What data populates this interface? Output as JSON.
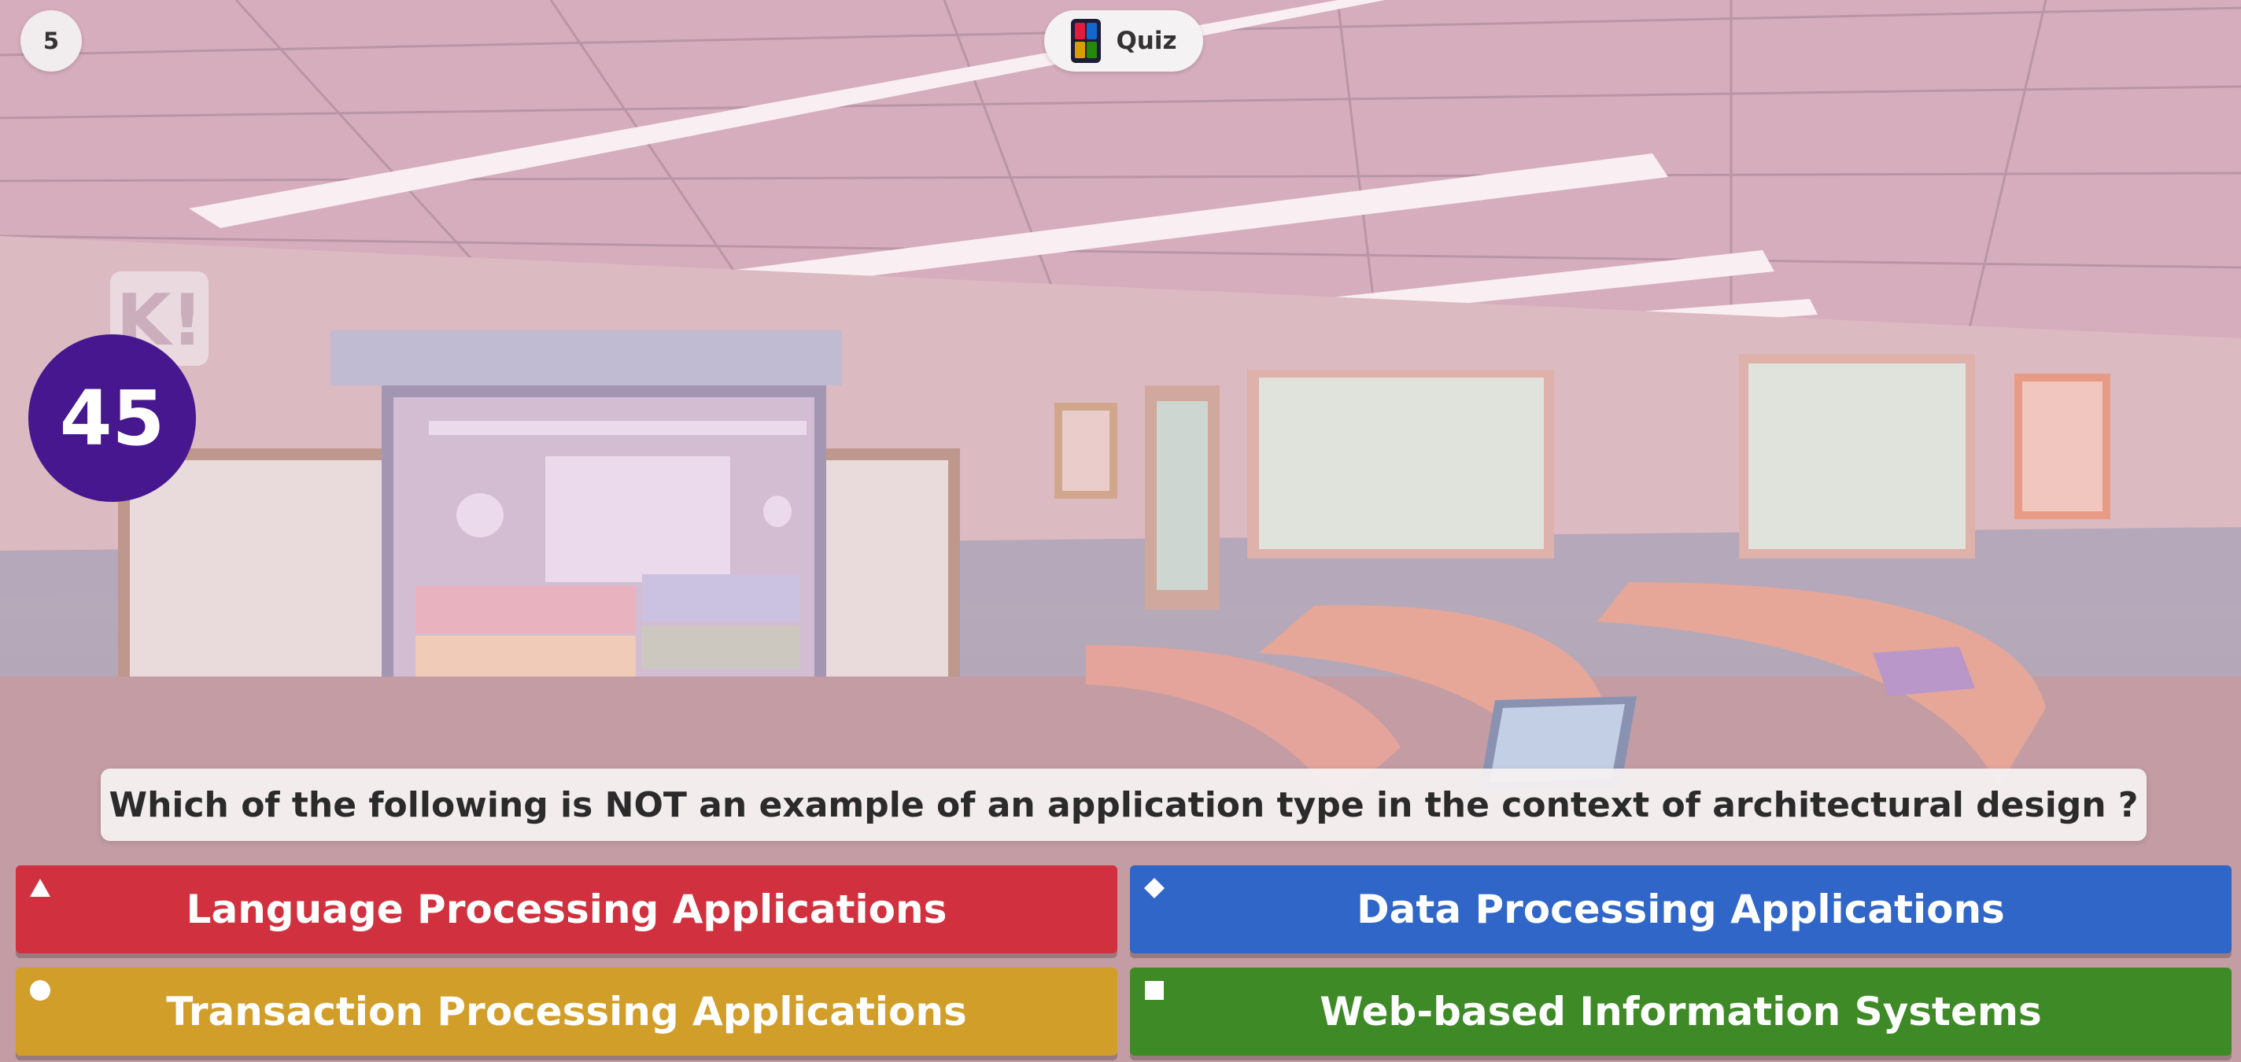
{
  "header": {
    "counter": "5",
    "app_title": "Quiz",
    "quiz_icon": "quiz-cards-icon"
  },
  "timer": {
    "seconds_left": "45"
  },
  "question": {
    "text": "Which of the following is NOT an example of an application type in the context of architectural design ?"
  },
  "answers": [
    {
      "label": "Language Processing Applications",
      "shape": "triangle-icon",
      "color": "#d1313f"
    },
    {
      "label": "Data Processing Applications",
      "shape": "diamond-icon",
      "color": "#2f66c8"
    },
    {
      "label": "Transaction Processing Applications",
      "shape": "circle-icon",
      "color": "#d29e2a"
    },
    {
      "label": "Web-based Information Systems",
      "shape": "square-icon",
      "color": "#3e8a27"
    }
  ],
  "theme": {
    "timer_color": "#46178f"
  }
}
